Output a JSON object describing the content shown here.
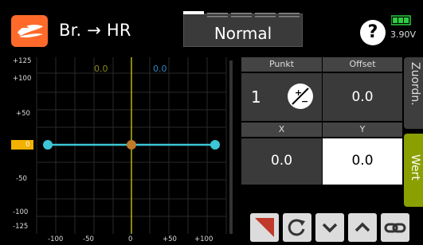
{
  "header": {
    "title": "Br. → HR",
    "mode": "Normal",
    "help_label": "?",
    "voltage": "3.90V",
    "accent_color": "#ff6a2b",
    "battery_color": "#2ecc40"
  },
  "graph": {
    "y_ticks": [
      "+125",
      "+100",
      "+50",
      "0",
      "-50",
      "-100",
      "-125"
    ],
    "x_ticks": [
      "-100",
      "-50",
      "0",
      "+50",
      "+100"
    ],
    "readout_left": "0.0",
    "readout_right": "0.0",
    "curve_color": "#3cc6d6",
    "point_color": "#c07a28"
  },
  "panel": {
    "header_punkt": "Punkt",
    "header_offset": "Offset",
    "punkt_value": "1",
    "offset_value": "0.0",
    "header_x": "X",
    "header_y": "Y",
    "x_value": "0.0",
    "y_value": "0.0",
    "tab_zuord": "Zuordn.",
    "tab_wert": "Wert"
  },
  "toolbar": {
    "buttons": [
      "corner-marker-icon",
      "reset-icon",
      "chevron-down-icon",
      "chevron-up-icon",
      "link-icon"
    ]
  }
}
